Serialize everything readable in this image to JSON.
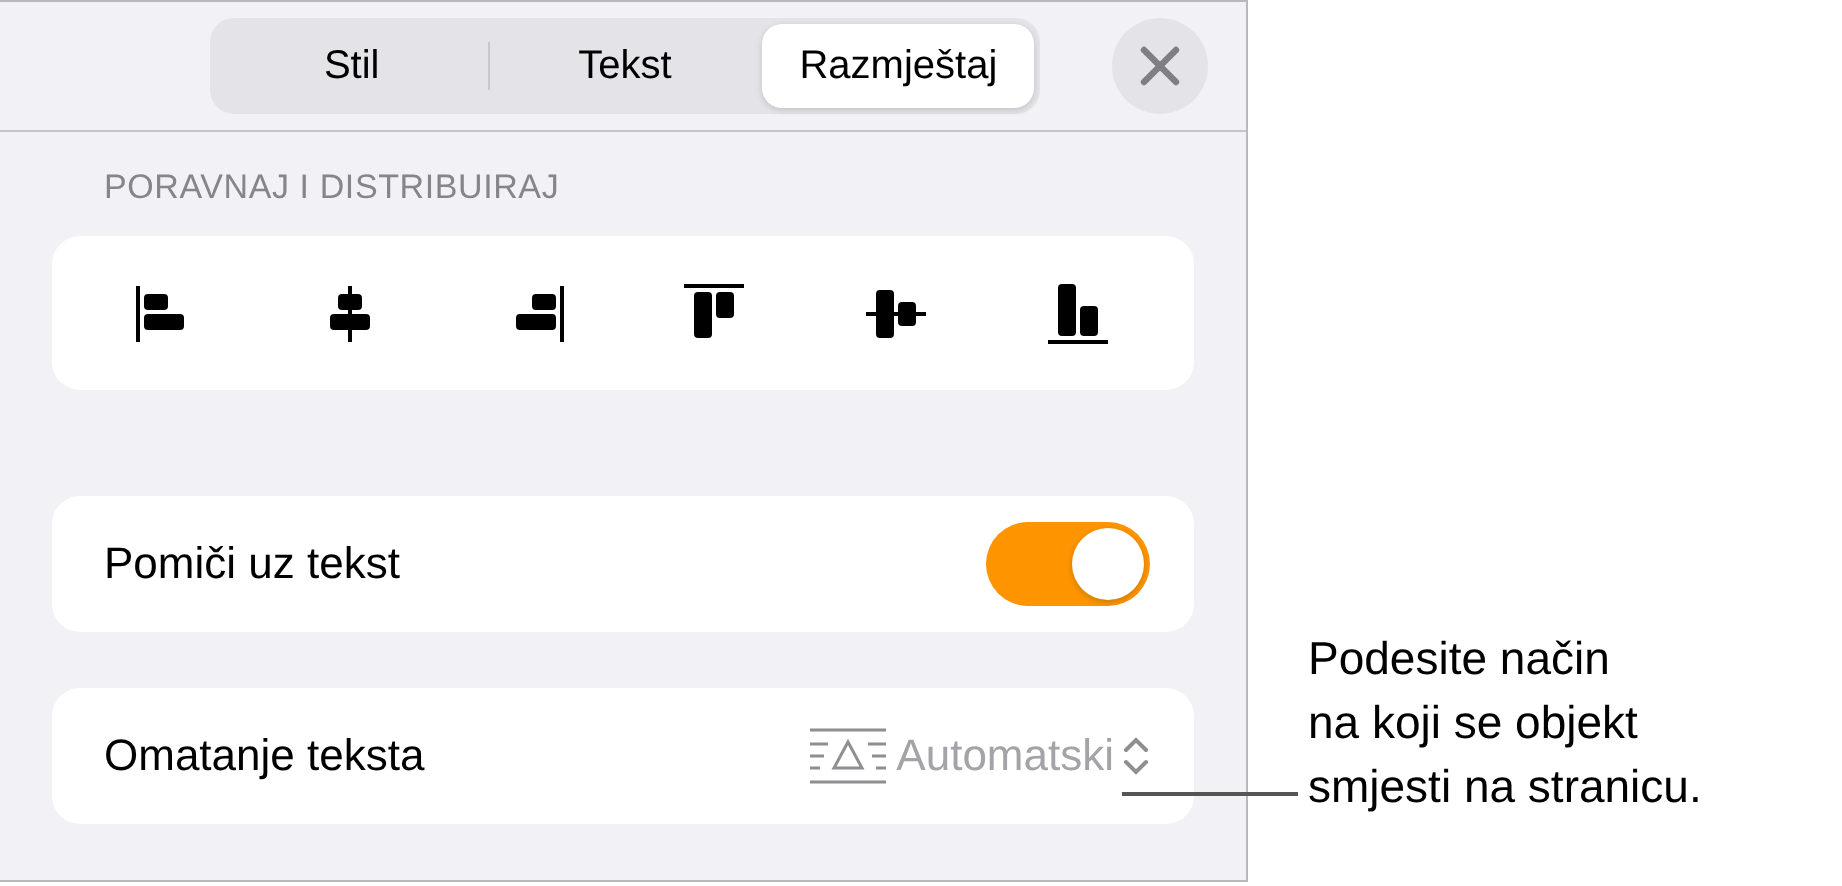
{
  "tabs": [
    {
      "label": "Stil",
      "selected": false
    },
    {
      "label": "Tekst",
      "selected": false
    },
    {
      "label": "Razmještaj",
      "selected": true
    }
  ],
  "section_title": "PORAVNAJ I DISTRIBUIRAJ",
  "move_with_text": {
    "label": "Pomiči uz tekst",
    "on": true
  },
  "text_wrap": {
    "label": "Omatanje teksta",
    "value": "Automatski"
  },
  "callout": "Podesite način\nna koji se objekt\nsmjesti na stranicu."
}
